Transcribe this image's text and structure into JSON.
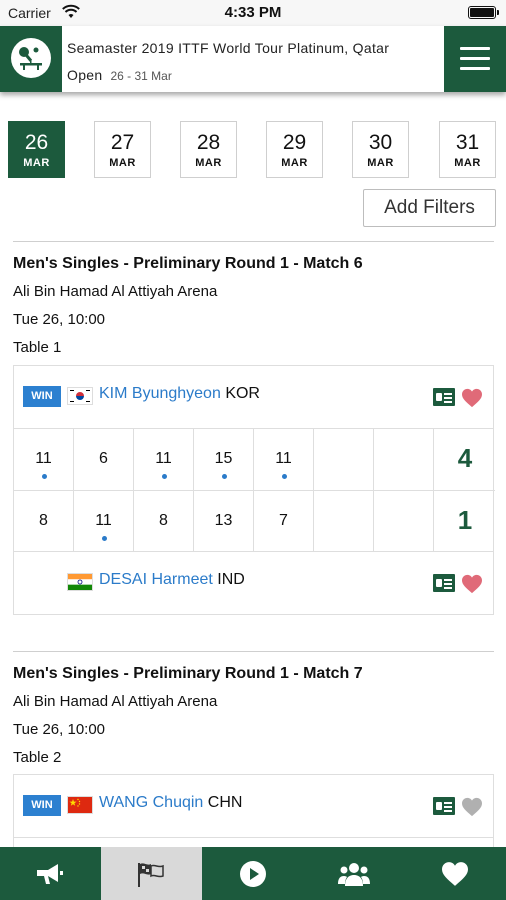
{
  "status_bar": {
    "carrier": "Carrier",
    "time": "4:33 PM"
  },
  "header": {
    "title": "Seamaster 2019 ITTF World Tour Platinum, Qatar Open",
    "dates": "26 - 31 Mar",
    "logo_icon": "table-tennis-logo-icon",
    "menu_icon": "hamburger-menu-icon"
  },
  "date_picker": {
    "dates": [
      {
        "day": "26",
        "month": "MAR",
        "selected": true
      },
      {
        "day": "27",
        "month": "MAR",
        "selected": false
      },
      {
        "day": "28",
        "month": "MAR",
        "selected": false
      },
      {
        "day": "29",
        "month": "MAR",
        "selected": false
      },
      {
        "day": "30",
        "month": "MAR",
        "selected": false
      },
      {
        "day": "31",
        "month": "MAR",
        "selected": false
      }
    ]
  },
  "filters_button": "Add Filters",
  "matches": [
    {
      "title": "Men's Singles - Preliminary Round 1 - Match 6",
      "venue": "Ali Bin Hamad Al Attiyah Arena",
      "datetime": "Tue 26, 10:00",
      "table": "Table 1",
      "player1": {
        "badge": "WIN",
        "name": "KIM Byunghyeon",
        "country": "KOR",
        "flag": "south-korea-flag",
        "favorite": true
      },
      "player2": {
        "badge": "",
        "name": "DESAI Harmeet",
        "country": "IND",
        "flag": "india-flag",
        "favorite": true
      },
      "scores_p1": [
        "11",
        "6",
        "11",
        "15",
        "11",
        "",
        ""
      ],
      "scores_p2": [
        "8",
        "11",
        "8",
        "13",
        "7",
        "",
        ""
      ],
      "game_winner": [
        1,
        2,
        1,
        1,
        1
      ],
      "total_p1": "4",
      "total_p2": "1"
    },
    {
      "title": "Men's Singles - Preliminary Round 1 - Match 7",
      "venue": "Ali Bin Hamad Al Attiyah Arena",
      "datetime": "Tue 26, 10:00",
      "table": "Table 2",
      "player1": {
        "badge": "WIN",
        "name": "WANG Chuqin",
        "country": "CHN",
        "flag": "china-flag",
        "favorite": false
      }
    }
  ],
  "tab_bar": {
    "tabs": [
      {
        "name": "news",
        "icon": "megaphone-icon",
        "active": false
      },
      {
        "name": "results",
        "icon": "flags-icon",
        "active": true
      },
      {
        "name": "video",
        "icon": "play-icon",
        "active": false
      },
      {
        "name": "players",
        "icon": "group-icon",
        "active": false
      },
      {
        "name": "favorites",
        "icon": "heart-icon",
        "active": false
      }
    ]
  },
  "colors": {
    "brand_green": "#1c5a3d",
    "link_blue": "#2b7bc9",
    "win_badge": "#2c80d0",
    "heart_favorite": "#e06a78",
    "heart_inactive": "#b0b0b0"
  }
}
